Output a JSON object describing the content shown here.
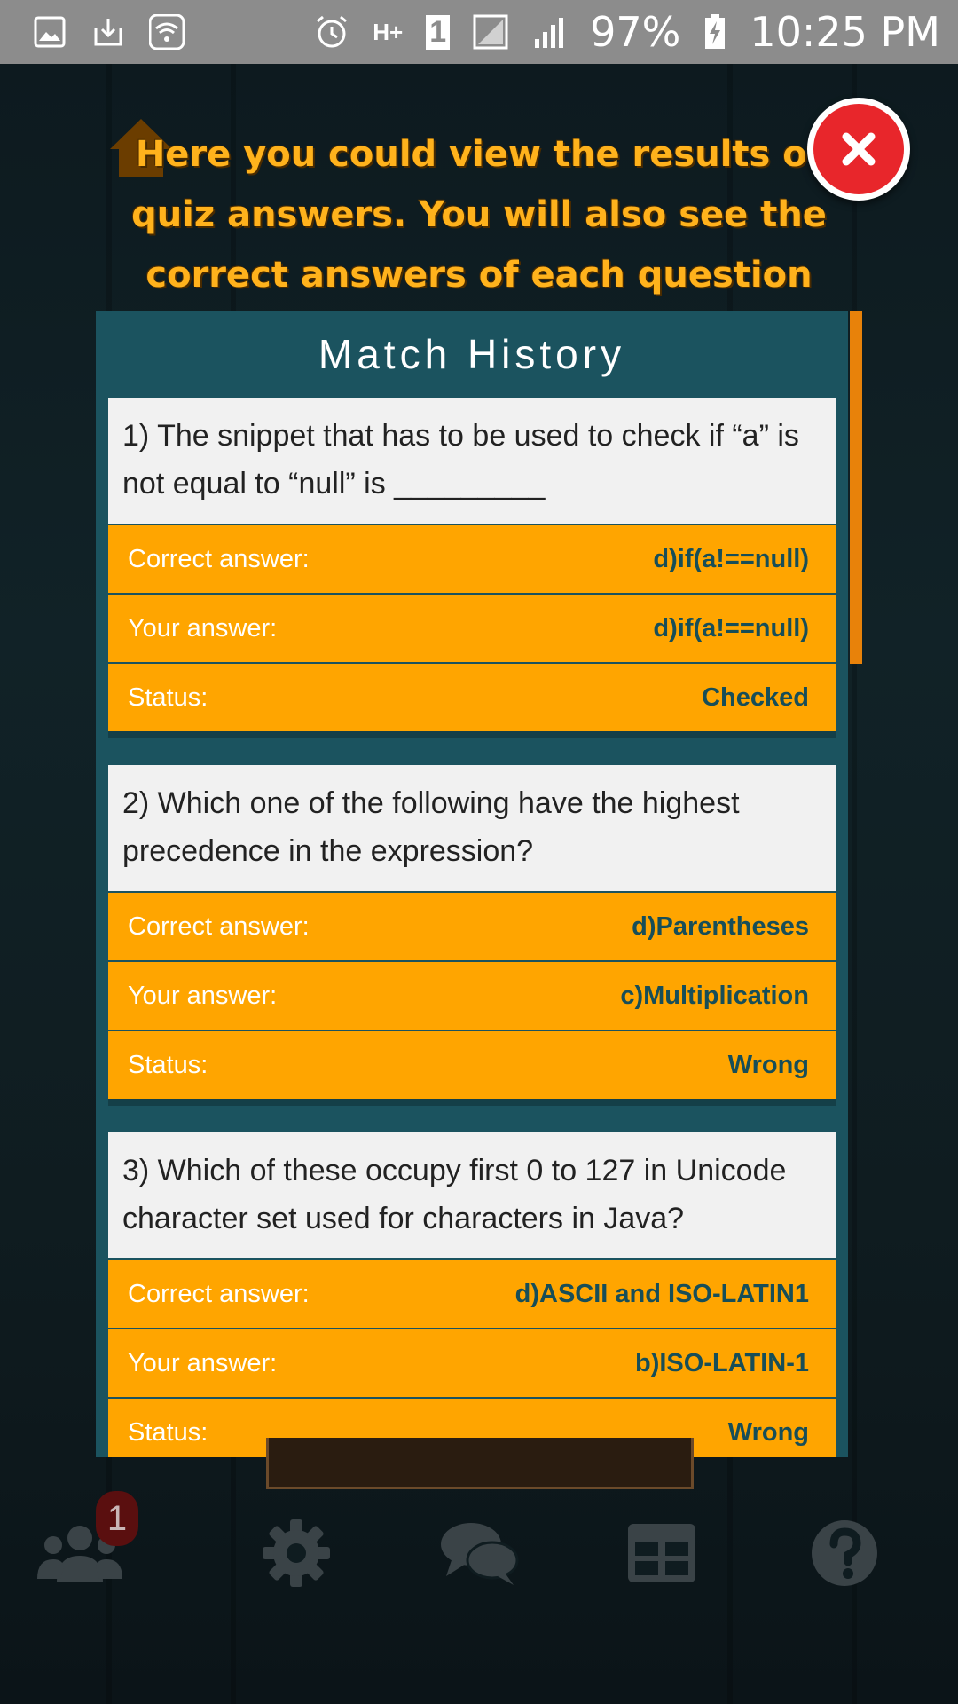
{
  "status_bar": {
    "battery": "97%",
    "time": "10:25 PM",
    "network": "H+",
    "sim": "1",
    "icons": [
      "image-icon",
      "download-icon",
      "wifi-icon",
      "alarm-icon",
      "signal-icon",
      "signal-icon",
      "battery-charging-icon"
    ]
  },
  "tutorial": {
    "text": "Here you could view the results of quiz answers. You will also see the correct answers of each question"
  },
  "panel": {
    "title": "Match History"
  },
  "labels": {
    "correct": "Correct answer:",
    "yours": "Your answer:",
    "status": "Status:"
  },
  "questions": [
    {
      "text": "1)  The snippet that has to be used to check if “a” is not equal to “null” is _________",
      "correct": "d)if(a!==null)",
      "yours": "d)if(a!==null)",
      "status": "Checked"
    },
    {
      "text": "2)  Which one of the following have the highest precedence in the expression?",
      "correct": "d)Parentheses",
      "yours": "c)Multiplication",
      "status": "Wrong"
    },
    {
      "text": "3)  Which of these occupy first 0 to 127 in Unicode character set used for characters in Java?",
      "correct": "d)ASCII and ISO-LATIN1",
      "yours": "b)ISO-LATIN-1",
      "status": "Wrong"
    }
  ],
  "bottom_nav": {
    "friends_badge": "1",
    "icons": [
      "friends-icon",
      "settings-icon",
      "chat-icon",
      "leaderboard-icon",
      "help-icon"
    ]
  },
  "colors": {
    "accent_orange": "#ffa500",
    "panel_teal": "#1b535f",
    "close_red": "#e8262b",
    "tutorial_text": "#ffb21c"
  }
}
